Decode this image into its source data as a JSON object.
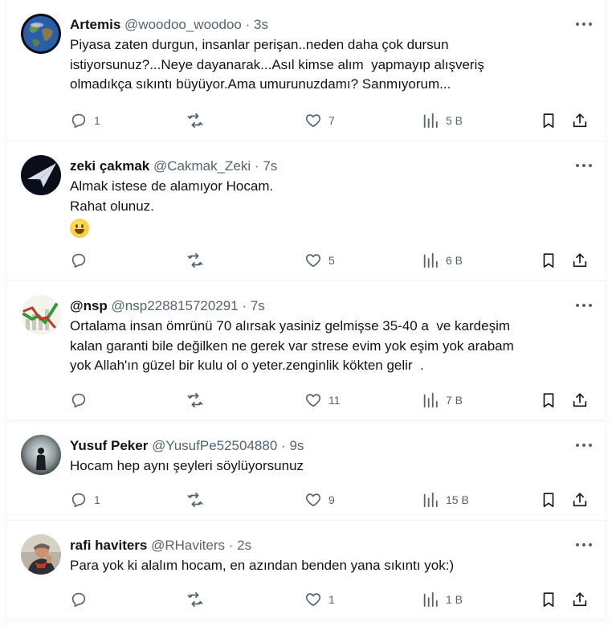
{
  "tweets": [
    {
      "name": "Artemis",
      "handle": "@woodoo_woodoo",
      "dot": "·",
      "time": "3s",
      "lines": [
        "Piyasa zaten durgun, insanlar perişan..neden daha çok dursun",
        "istiyorsunuz?...Neye dayanarak...Asıl kimse alım  yapmayıp alışveriş",
        "olmadıkça sıkıntı büyüyor.Ama umurunuzdamı? Sanmıyorum..."
      ],
      "replies": "1",
      "reposts": "",
      "likes": "7",
      "views": "5 B"
    },
    {
      "name": "zeki çakmak",
      "handle": "@Cakmak_Zeki",
      "dot": "·",
      "time": "7s",
      "lines": [
        "Almak istese de alamıyor Hocam.",
        "Rahat olunuz."
      ],
      "emoji": "grinning-face-emoji",
      "replies": "",
      "reposts": "",
      "likes": "5",
      "views": "6 B"
    },
    {
      "name": "@nsp",
      "handle": "@nsp228815720291",
      "dot": "·",
      "time": "7s",
      "lines": [
        "Ortalama insan ömrünü 70 alırsak yasiniz gelmişse 35-40 a  ve kardeşim",
        "kalan garanti bile değilken ne gerek var strese evim yok eşim yok arabam",
        "yok Allah'ın güzel bir kulu ol o yeter.zenginlik kökten gelir  ."
      ],
      "replies": "",
      "reposts": "",
      "likes": "11",
      "views": "7 B"
    },
    {
      "name": "Yusuf Peker",
      "handle": "@YusufPe52504880",
      "dot": "·",
      "time": "9s",
      "lines": [
        "Hocam hep aynı şeyleri söylüyorsunuz"
      ],
      "replies": "1",
      "reposts": "",
      "likes": "9",
      "views": "15 B"
    },
    {
      "name": "rafi haviters",
      "handle": "@RHaviters",
      "dot": "·",
      "time": "2s",
      "lines": [
        "Para yok ki alalım hocam, en azından benden yana sıkıntı yok:)"
      ],
      "replies": "",
      "reposts": "",
      "likes": "1",
      "views": "1 B"
    }
  ],
  "icons": {
    "reply": "reply-icon",
    "repost": "repost-icon",
    "like": "like-icon",
    "views": "views-icon",
    "bookmark": "bookmark-icon",
    "share": "share-icon",
    "more": "more-icon"
  },
  "colors": {
    "icon_gray": "#536471",
    "text": "#0f1419",
    "border": "#eff3f4"
  }
}
